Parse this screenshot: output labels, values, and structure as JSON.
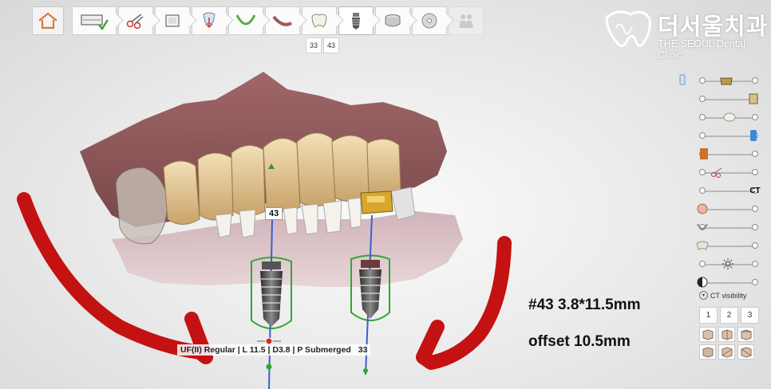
{
  "toolbar": {
    "home_icon": "home-icon",
    "steps": [
      {
        "icon": "scan-check-icon",
        "state": "done"
      },
      {
        "icon": "scissors-icon",
        "state": "normal"
      },
      {
        "icon": "crop-icon",
        "state": "normal"
      },
      {
        "icon": "tooth-align-icon",
        "state": "normal"
      },
      {
        "icon": "arch-icon",
        "state": "normal"
      },
      {
        "icon": "nerve-icon",
        "state": "normal"
      },
      {
        "icon": "tooth-icon",
        "state": "normal"
      },
      {
        "icon": "implant-icon",
        "state": "active"
      },
      {
        "icon": "sleeve-icon",
        "state": "normal"
      },
      {
        "icon": "disc-icon",
        "state": "normal"
      },
      {
        "icon": "people-icon",
        "state": "disabled"
      }
    ],
    "tooth_tabs": [
      "33",
      "43"
    ]
  },
  "clinic": {
    "name_ko": "더서울치과",
    "name_en": "THE SEOUL Dental Clinic",
    "logo_color": "#ffffff"
  },
  "viewport": {
    "tooth_label_top": "43",
    "implant_info": "UF(II) Regular | L 11.5 | D3.8 | P Submerged",
    "implant_label_right": "33",
    "annotation_line1": "#43  3.8*11.5mm",
    "annotation_line2": "offset  10.5mm",
    "arrow_color": "#c41212",
    "guide_color": "#2fa82f",
    "axis_color": "#3a5fd0"
  },
  "right_panel": {
    "sliders": [
      {
        "icon": "crown-gold-icon",
        "label": ""
      },
      {
        "icon": "abutment-icon",
        "label": ""
      },
      {
        "icon": "tooth-white-icon",
        "label": ""
      },
      {
        "icon": "sleeve-blue-icon",
        "label": ""
      },
      {
        "icon": "cylinder-bronze-icon",
        "label": ""
      },
      {
        "icon": "scissors-icon",
        "label": ""
      },
      {
        "icon": "ct-icon",
        "label": "CT"
      },
      {
        "icon": "face-icon",
        "label": ""
      },
      {
        "icon": "jaw-icon",
        "label": ""
      },
      {
        "icon": "molar-icon",
        "label": ""
      },
      {
        "icon": "brightness-icon",
        "label": ""
      },
      {
        "icon": "contrast-icon",
        "label": ""
      }
    ],
    "ct_visibility_label": "CT visibility",
    "numbers": [
      "1",
      "2",
      "3"
    ],
    "view_cubes": [
      "front",
      "left",
      "right",
      "back",
      "top",
      "bottom"
    ]
  }
}
